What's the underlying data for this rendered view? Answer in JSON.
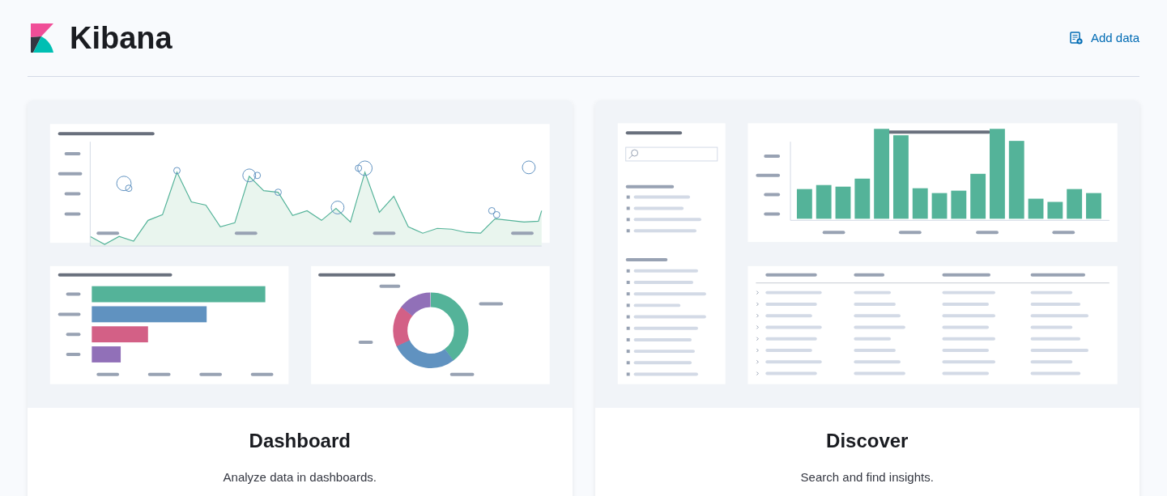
{
  "header": {
    "title": "Kibana",
    "action": "Add data"
  },
  "cards": [
    {
      "kind": "dashboard",
      "title": "Dashboard",
      "description": "Analyze data in dashboards."
    },
    {
      "kind": "discover",
      "title": "Discover",
      "description": "Search and find insights."
    }
  ]
}
